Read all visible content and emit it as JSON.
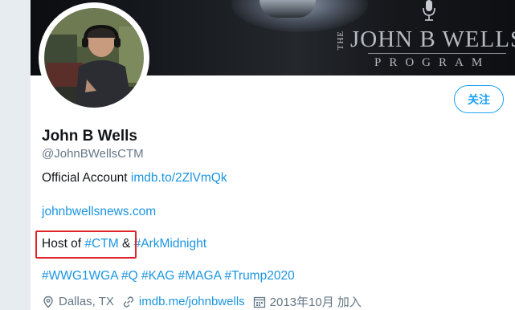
{
  "banner": {
    "brand_the": "THE",
    "brand_name": "JOHN B WELLS",
    "brand_program": "PROGRAM"
  },
  "profile": {
    "display_name": "John B Wells",
    "handle": "@JohnBWellsCTM",
    "follow_label": "关注"
  },
  "bio": {
    "line1_text": "Official Account",
    "line1_link": "imdb.to/2ZlVmQk",
    "line2_link": "johnbwellsnews.com",
    "line3_prefix": "Host of",
    "line3_tag1": "#CTM",
    "line3_amp": "&",
    "line3_tag2": "#ArkMidnight",
    "line4_tags": "#WWG1WGA #Q #KAG #MAGA #Trump2020"
  },
  "meta": {
    "location": "Dallas, TX",
    "website": "imdb.me/johnbwells",
    "joined": "2013年10月 加入"
  },
  "colors": {
    "link": "#1b95e0",
    "follow_border": "#1da1f2",
    "highlight": "#e0252a",
    "secondary_text": "#657786"
  },
  "icons": [
    "location-pin-icon",
    "link-icon",
    "calendar-icon",
    "microphone-icon"
  ]
}
